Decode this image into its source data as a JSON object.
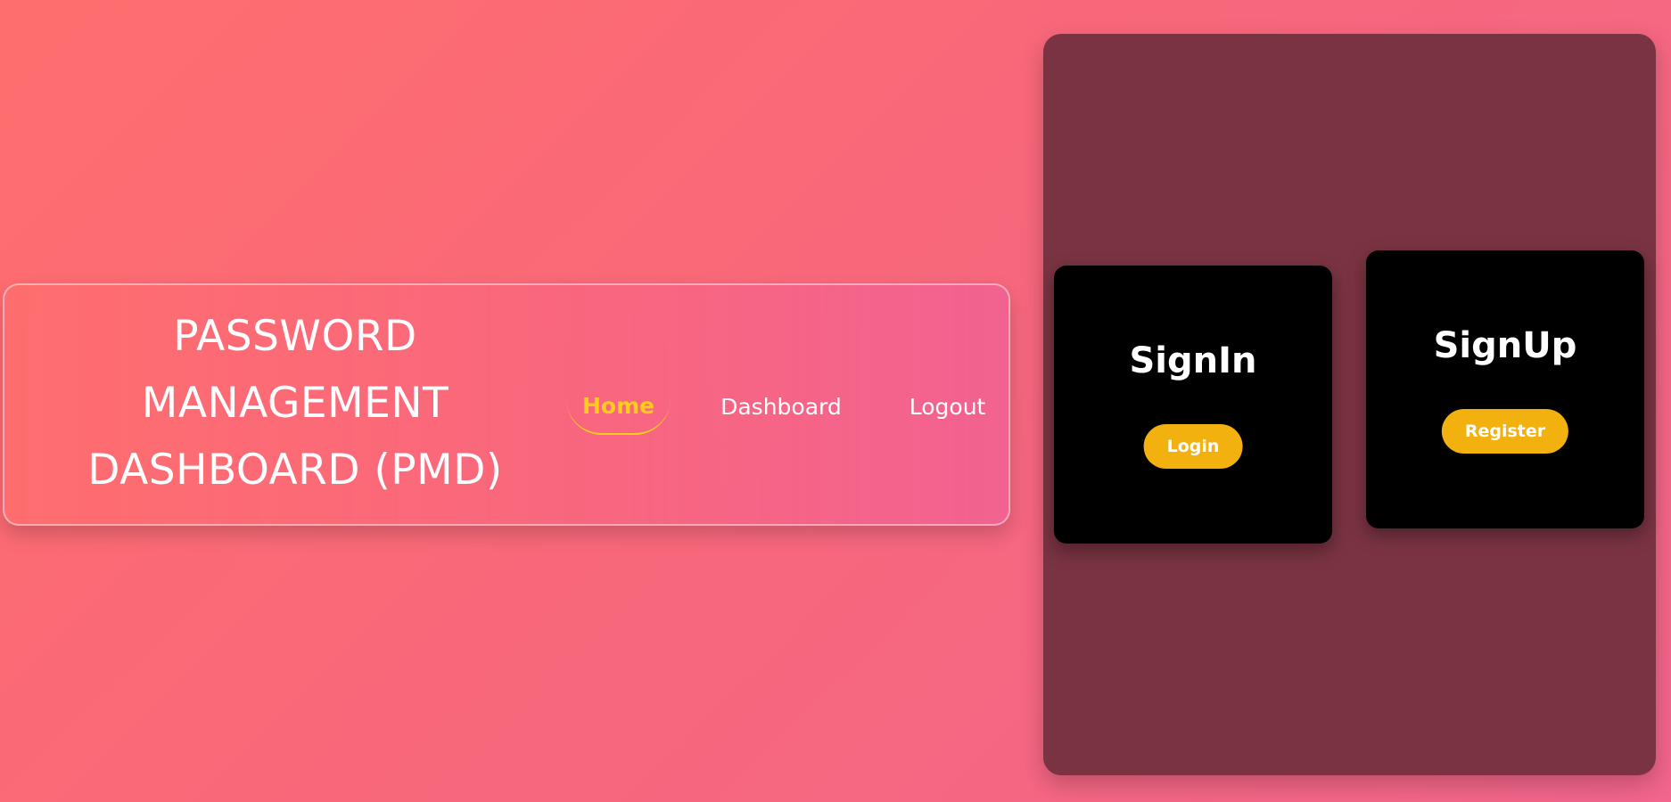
{
  "header": {
    "brand_line1": "PASSWORD",
    "brand_line2": "MANAGEMENT",
    "brand_line3": "DASHBOARD (PMD)",
    "nav": {
      "home": "Home",
      "dashboard": "Dashboard",
      "logout": "Logout"
    }
  },
  "auth": {
    "signin": {
      "title": "SignIn",
      "button": "Login"
    },
    "signup": {
      "title": "SignUp",
      "button": "Register"
    }
  },
  "colors": {
    "accent": "#ffcc1a",
    "button": "#f2b10f",
    "panel": "#7a3342",
    "card": "#000000"
  }
}
